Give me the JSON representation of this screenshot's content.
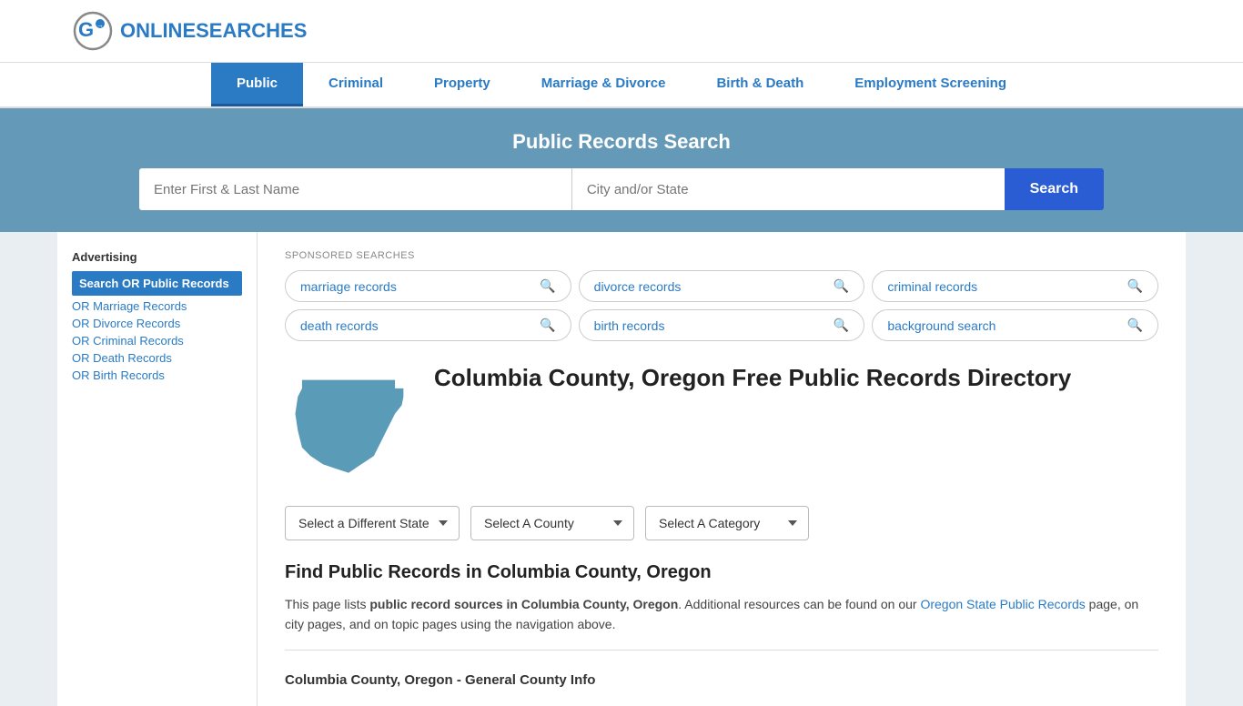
{
  "site": {
    "logo_text_plain": "ONLINE",
    "logo_text_brand": "SEARCHES"
  },
  "nav": {
    "items": [
      {
        "id": "public",
        "label": "Public",
        "active": true
      },
      {
        "id": "criminal",
        "label": "Criminal",
        "active": false
      },
      {
        "id": "property",
        "label": "Property",
        "active": false
      },
      {
        "id": "marriage-divorce",
        "label": "Marriage & Divorce",
        "active": false
      },
      {
        "id": "birth-death",
        "label": "Birth & Death",
        "active": false
      },
      {
        "id": "employment",
        "label": "Employment Screening",
        "active": false
      }
    ]
  },
  "search_banner": {
    "title": "Public Records Search",
    "name_placeholder": "Enter First & Last Name",
    "location_placeholder": "City and/or State",
    "button_label": "Search"
  },
  "sponsored": {
    "section_label": "SPONSORED SEARCHES",
    "tags": [
      {
        "id": "marriage",
        "label": "marriage records"
      },
      {
        "id": "divorce",
        "label": "divorce records"
      },
      {
        "id": "criminal",
        "label": "criminal records"
      },
      {
        "id": "death",
        "label": "death records"
      },
      {
        "id": "birth",
        "label": "birth records"
      },
      {
        "id": "background",
        "label": "background search"
      }
    ]
  },
  "page": {
    "title": "Columbia County, Oregon Free Public Records Directory",
    "dropdowns": {
      "state_label": "Select a Different State",
      "county_label": "Select A County",
      "category_label": "Select A Category"
    },
    "find_section": {
      "heading": "Find Public Records in Columbia County, Oregon",
      "body_start": "This page lists ",
      "body_bold": "public record sources in Columbia County, Oregon",
      "body_end": ". Additional resources can be found on our ",
      "link_text": "Oregon State Public Records",
      "body_rest": " page, on city pages, and on topic pages using the navigation above."
    },
    "general_info_title": "Columbia County, Oregon - General County Info"
  },
  "sidebar": {
    "ad_title": "Advertising",
    "links": [
      {
        "id": "search-or",
        "label": "Search OR Public Records",
        "highlighted": true
      },
      {
        "id": "or-marriage",
        "label": "OR Marriage Records"
      },
      {
        "id": "or-divorce",
        "label": "OR Divorce Records"
      },
      {
        "id": "or-criminal",
        "label": "OR Criminal Records"
      },
      {
        "id": "or-death",
        "label": "OR Death Records"
      },
      {
        "id": "or-birth",
        "label": "OR Birth Records"
      }
    ]
  }
}
